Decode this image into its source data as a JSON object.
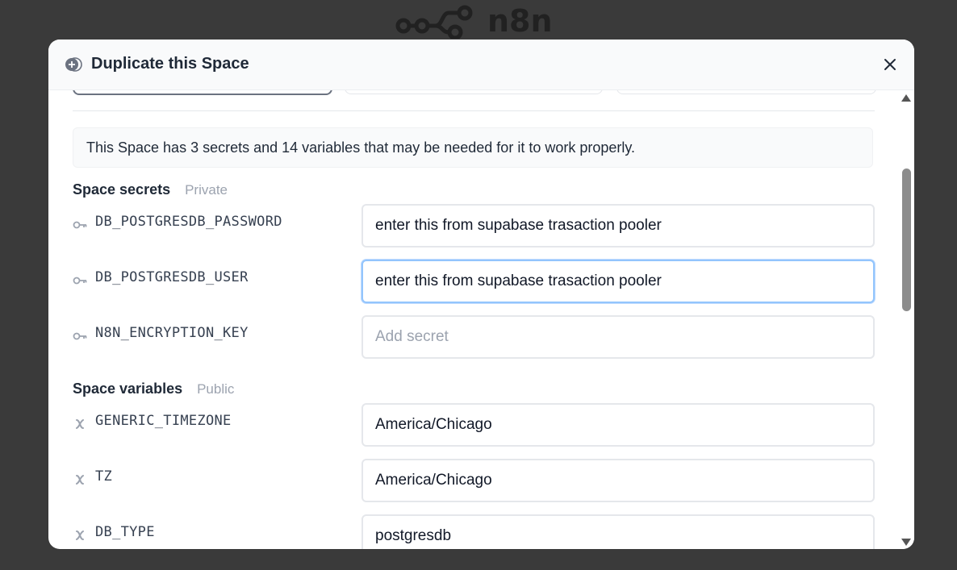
{
  "background": {
    "logo_text": "n8n"
  },
  "modal": {
    "title": "Duplicate this Space",
    "info_text": "This Space has 3 secrets and 14 variables that may be needed for it to work properly.",
    "secrets_section": {
      "title": "Space secrets",
      "tag": "Private",
      "items": [
        {
          "name": "DB_POSTGRESDB_PASSWORD",
          "value": "enter this from supabase trasaction pooler",
          "placeholder": "Add secret"
        },
        {
          "name": "DB_POSTGRESDB_USER",
          "value": "enter this from supabase trasaction pooler",
          "placeholder": "Add secret"
        },
        {
          "name": "N8N_ENCRYPTION_KEY",
          "value": "",
          "placeholder": "Add secret"
        }
      ]
    },
    "variables_section": {
      "title": "Space variables",
      "tag": "Public",
      "items": [
        {
          "name": "GENERIC_TIMEZONE",
          "value": "America/Chicago"
        },
        {
          "name": "TZ",
          "value": "America/Chicago"
        },
        {
          "name": "DB_TYPE",
          "value": "postgresdb"
        }
      ]
    }
  },
  "colors": {
    "overlay": "#3a3a3a",
    "focus_border": "#93c5fd",
    "muted_text": "#9ca3af"
  }
}
